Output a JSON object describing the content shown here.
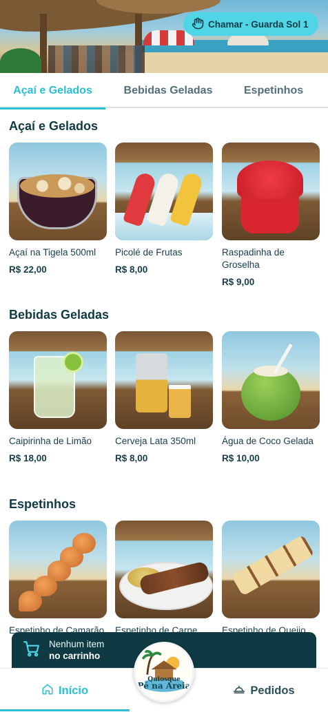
{
  "header": {
    "call_button_label": "Chamar - Guarda Sol 1",
    "call_icon": "hand-icon"
  },
  "tabs": [
    {
      "label": "Açaí e Gelados",
      "active": true
    },
    {
      "label": "Bebidas Geladas",
      "active": false
    },
    {
      "label": "Espetinhos",
      "active": false
    }
  ],
  "sections": [
    {
      "title": "Açaí e Gelados",
      "items": [
        {
          "name": "Açaí na Tigela 500ml",
          "price": "R$ 22,00"
        },
        {
          "name": "Picolé de Frutas",
          "price": "R$ 8,00"
        },
        {
          "name": "Raspadinha de Groselha",
          "price": "R$ 9,00"
        }
      ]
    },
    {
      "title": "Bebidas Geladas",
      "items": [
        {
          "name": "Caipirinha de Limão",
          "price": "R$ 18,00"
        },
        {
          "name": "Cerveja Lata 350ml",
          "price": "R$ 8,00"
        },
        {
          "name": "Água de Coco Gelada",
          "price": "R$ 10,00"
        }
      ]
    },
    {
      "title": "Espetinhos",
      "items": [
        {
          "name": "Espetinho de Camarão",
          "price": ""
        },
        {
          "name": "Espetinho de Carne",
          "price": ""
        },
        {
          "name": "Espetinho de Queijo",
          "price": ""
        }
      ]
    }
  ],
  "cart": {
    "line1": "Nenhum item",
    "line2": "no carrinho",
    "icon": "cart-icon"
  },
  "bottom_nav": {
    "home_label": "Início",
    "orders_label": "Pedidos"
  },
  "logo": {
    "line1": "Quiosque",
    "line2": "Pé na Areia"
  },
  "colors": {
    "accent": "#2bbfd4",
    "call_button": "#4fd5e6",
    "dark": "#0f3a44"
  }
}
